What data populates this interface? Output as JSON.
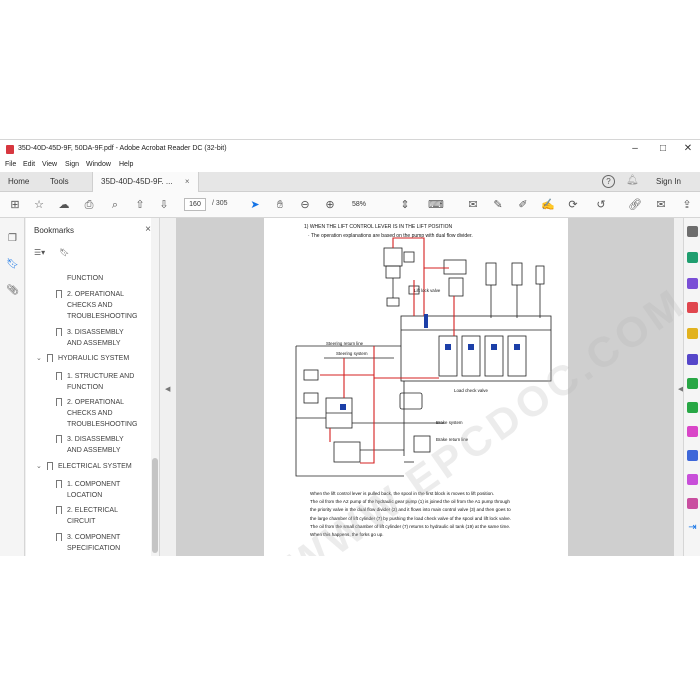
{
  "window": {
    "title": "35D-40D-45D-9F, 50DA-9F.pdf - Adobe Acrobat Reader DC (32-bit)",
    "minimize_glyph": "–",
    "maximize_glyph": "□",
    "close_glyph": "✕"
  },
  "menu": [
    "File",
    "Edit",
    "View",
    "Sign",
    "Window",
    "Help"
  ],
  "tabs": {
    "home": "Home",
    "tools": "Tools",
    "document": "35D-40D-45D-9F. ...",
    "close_glyph": "×"
  },
  "header_right": {
    "sign_in": "Sign In"
  },
  "toolbar": {
    "page_current": "160",
    "page_total": "/ 305",
    "zoom": "58%"
  },
  "bookmarks": {
    "title": "Bookmarks",
    "close_glyph": "×",
    "items": [
      "FUNCTION",
      "2. OPERATIONAL",
      "CHECKS AND",
      "TROUBLESHOOTING",
      "3. DISASSEMBLY",
      "AND ASSEMBLY",
      "HYDRAULIC SYSTEM",
      "1. STRUCTURE AND",
      "FUNCTION",
      "2. OPERATIONAL",
      "CHECKS AND",
      "TROUBLESHOOTING",
      "3. DISASSEMBLY",
      "AND ASSEMBLY",
      "ELECTRICAL SYSTEM",
      "1. COMPONENT",
      "LOCATION",
      "2. ELECTRICAL",
      "CIRCUIT",
      "3. COMPONENT",
      "SPECIFICATION"
    ]
  },
  "document": {
    "heading": "1) WHEN THE LIFT CONTROL LEVER IS IN THE LIFT POSITION",
    "subheading": "· The operation explanations are based on the pump with dual flow divider.",
    "labels": {
      "steering_return": "Steering return line",
      "steering_system": "Steering system",
      "lift_lock": "Lift lock valve",
      "load_check": "Load check valve",
      "brake_system": "Brake system",
      "brake_return": "Brake return line"
    },
    "body": [
      "When the lift control lever is pulled back, the spool in the first block is moves to lift position.",
      "The oil from the A2 pump of the hydraulic gear pump (1) is joined the oil from the A1 pump through",
      "the priority valve in the dual flow divider (2) and it flows into main control valve (3) and then goes to",
      "the large chamber of lift cylinder (7) by pushing the load check valve of the spool and lift lock valve.",
      "The oil from the small chamber of lift cylinder (7) returns to hydraulic oil tank (19) at the same time.",
      "When this happens, the forks go up."
    ]
  },
  "watermark": "WWW.EPCDOC.COM",
  "colors": {
    "accent": "#1473e6",
    "pdf_red": "#d7373f",
    "diagram_red": "#d42020"
  }
}
